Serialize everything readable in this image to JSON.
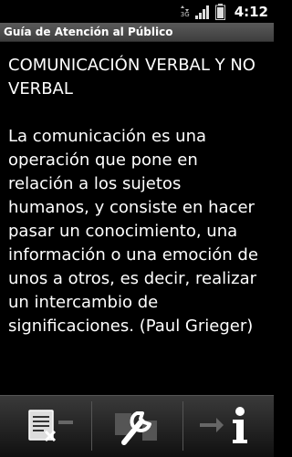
{
  "status_bar": {
    "network_label": "3G",
    "time": "4:12"
  },
  "app": {
    "title": "Guía de Atención al Público"
  },
  "content": {
    "heading": "COMUNICACIÓN VERBAL Y NO VERBAL",
    "body": "La comunicación es una operación que pone en relación a los sujetos humanos, y consiste en hacer pasar un conocimiento, una información o una emoción de unos a otros, es decir, realizar un intercambio de significaciones. (Paul Grieger)"
  },
  "bottom_bar": {
    "buttons": [
      {
        "name": "previous",
        "icon": "document-back-icon"
      },
      {
        "name": "tools",
        "icon": "wrench-icon"
      },
      {
        "name": "next-info",
        "icon": "info-icon"
      }
    ]
  }
}
